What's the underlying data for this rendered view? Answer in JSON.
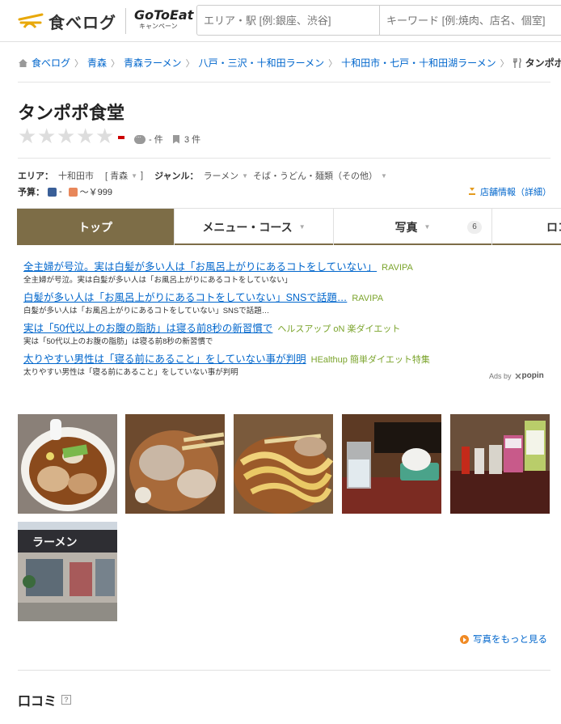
{
  "header": {
    "logo_text": "食べログ",
    "campaign_main": "GoToEat",
    "campaign_sub": "キャンペーン",
    "search_area_placeholder": "エリア・駅 [例:銀座、渋谷]",
    "search_keyword_placeholder": "キーワード [例:焼肉、店名、個室]"
  },
  "breadcrumb": [
    "食べログ",
    "青森",
    "青森ラーメン",
    "八戸・三沢・十和田ラーメン",
    "十和田市・七戸・十和田湖ラーメン"
  ],
  "breadcrumb_current": "タンポポ食堂",
  "restaurant": {
    "name": "タンポポ食堂",
    "review_count": "- 件",
    "bookmark_count": "3 件"
  },
  "info": {
    "area_label": "エリア：",
    "area_value": "十和田市",
    "area_tag": "[ 青森",
    "area_tag_end": "]",
    "genre_label": "ジャンル：",
    "genre_value": "ラーメン",
    "genre_value2": "そば・うどん・麺類（その他）",
    "budget_label": "予算：",
    "budget_dinner": "-",
    "budget_lunch": "～￥999",
    "detail_link": "店舗情報（詳細）"
  },
  "tabs": [
    {
      "label": "トップ",
      "active": true
    },
    {
      "label": "メニュー・コース"
    },
    {
      "label": "写真",
      "badge": "6"
    },
    {
      "label": "ロコ"
    }
  ],
  "ads": [
    {
      "headline": "全主婦が号泣。実は白髪が多い人は「お風呂上がりにあるコトをしていない」",
      "source": "RAVIPA",
      "desc": "全主婦が号泣。実は白髪が多い人は「お風呂上がりにあるコトをしていない」"
    },
    {
      "headline": "白髪が多い人は「お風呂上がりにあるコトをしていない」SNSで話題…",
      "source": "RAVIPA",
      "desc": "白髪が多い人は「お風呂上がりにあるコトをしていない」SNSで話題…"
    },
    {
      "headline": "実は「50代以上のお腹の脂肪」は寝る前8秒の新習慣で",
      "source": "ヘルスアップ oN 楽ダイエット",
      "desc": "実は「50代以上のお腹の脂肪」は寝る前8秒の新習慣で"
    },
    {
      "headline": "太りやすい男性は「寝る前にあること」をしていない事が判明",
      "source": "HEalthup 簡単ダイエット特集",
      "desc": "太りやすい男性は「寝る前にあること」をしていない事が判明"
    }
  ],
  "ads_by": "Ads by",
  "ads_brand": "popin",
  "photos_more": "写真をもっと見る",
  "shop_sign": "ラーメン",
  "reviews_title": "口コミ",
  "colors": {
    "tab_active": "#7d6d47",
    "link": "#0066cc",
    "ad_source": "#7ba42c"
  }
}
